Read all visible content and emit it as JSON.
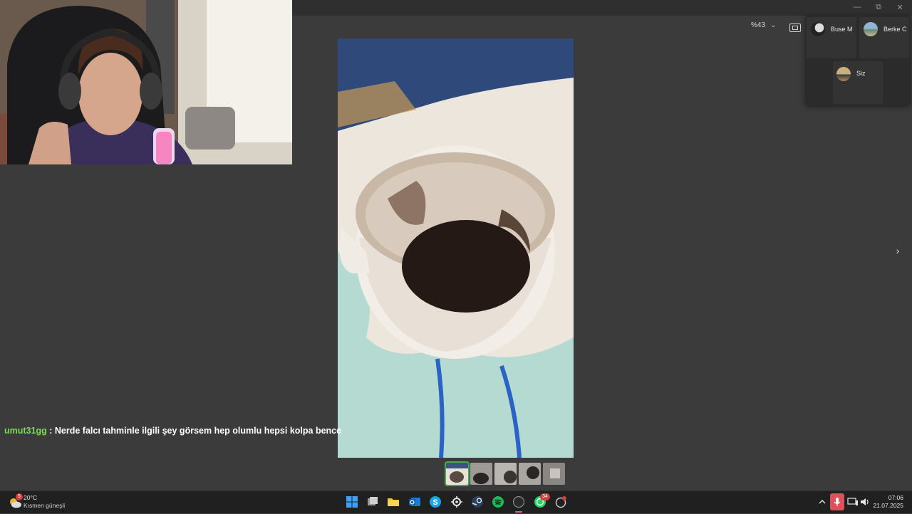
{
  "window": {
    "minimize": "—",
    "maximize": "⧉",
    "close": "✕"
  },
  "toolbar": {
    "zoom": "%43",
    "zoom_chevron": "⌄"
  },
  "participants": [
    {
      "name": "Buse M"
    },
    {
      "name": "Berke C"
    },
    {
      "name": "Siz"
    }
  ],
  "viewer": {
    "next": "›",
    "thumbnail_count": 5,
    "selected_thumbnail": 1
  },
  "chat": {
    "username": "umut31gg",
    "separator": ":",
    "message": "Nerde falcı tahminle ilgili şey görsem hep olumlu hepsi kolpa bence"
  },
  "taskbar": {
    "weather": {
      "temp": "20°C",
      "desc": "Kısmen güneşli",
      "badge": "5"
    },
    "whatsapp_badge": "34",
    "clock": {
      "time": "07:06",
      "date": "21.07.2025"
    }
  },
  "colors": {
    "accent_green": "#3fae4f",
    "chat_user": "#7ed957",
    "mic_active": "#e0505a",
    "background": "#3b3b3b"
  }
}
